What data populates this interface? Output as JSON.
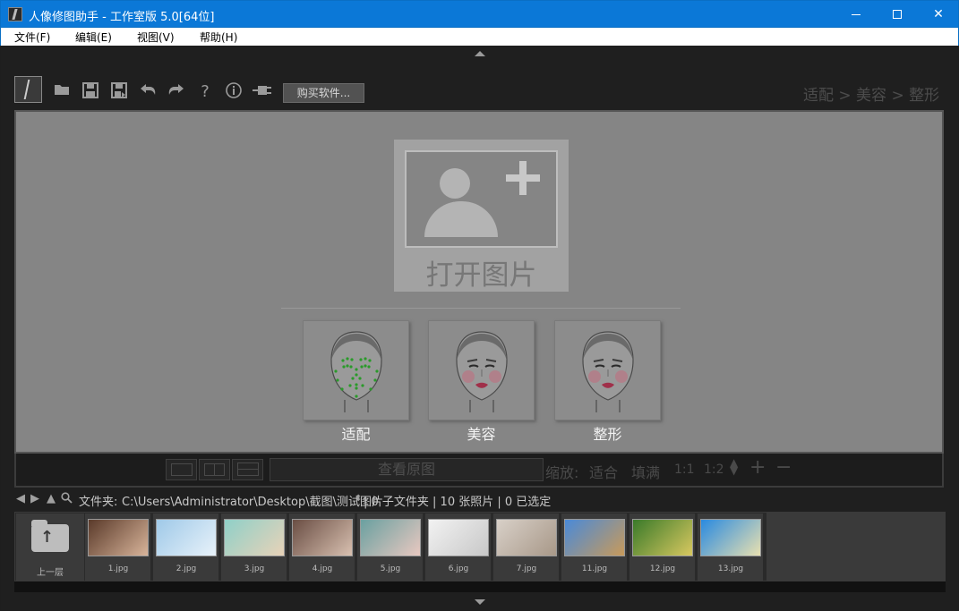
{
  "window": {
    "title": "人像修图助手 - 工作室版 5.0[64位]"
  },
  "menu": {
    "items": [
      {
        "label": "文件(F)"
      },
      {
        "label": "编辑(E)"
      },
      {
        "label": "视图(V)"
      },
      {
        "label": "帮助(H)"
      }
    ]
  },
  "toolbar": {
    "icons": [
      "logo-icon",
      "open-folder-icon",
      "save-icon",
      "save-as-icon",
      "undo-icon",
      "redo-icon",
      "help-icon",
      "info-icon",
      "plugin-icon"
    ],
    "buy_label": "购买软件...",
    "workflow": "适配 > 美容 > 整形"
  },
  "canvas": {
    "open_label": "打开图片",
    "modes": [
      {
        "label": "适配"
      },
      {
        "label": "美容"
      },
      {
        "label": "整形"
      }
    ]
  },
  "controls": {
    "view_original": "查看原图",
    "zoom_label": "缩放:",
    "fit_label": "适合",
    "fill_label": "填满",
    "ratio_1": "1:1",
    "ratio_2": "1:2",
    "plus": "+",
    "minus": "−"
  },
  "pathbar": {
    "folder_label": "文件夹:",
    "path": "C:\\Users\\Administrator\\Desktop\\截图\\测试图片",
    "stats": "| 0 子文件夹 | 10 张照片 | 0 已选定"
  },
  "thumbnails": {
    "up_label": "上一层",
    "files": [
      {
        "name": "1.jpg",
        "colors": [
          "#5a3a2a",
          "#d8b49a"
        ]
      },
      {
        "name": "2.jpg",
        "colors": [
          "#9fc9e8",
          "#e8f2fa"
        ]
      },
      {
        "name": "3.jpg",
        "colors": [
          "#8fd0c8",
          "#e8d2b8"
        ]
      },
      {
        "name": "4.jpg",
        "colors": [
          "#6a4e44",
          "#d8c0b0"
        ]
      },
      {
        "name": "5.jpg",
        "colors": [
          "#6aa0a0",
          "#e8c8c0"
        ]
      },
      {
        "name": "6.jpg",
        "colors": [
          "#f2f2f2",
          "#c8c8c8"
        ]
      },
      {
        "name": "7.jpg",
        "colors": [
          "#d8d0c8",
          "#a89888"
        ]
      },
      {
        "name": "11.jpg",
        "colors": [
          "#4a8ad8",
          "#c89a5a"
        ]
      },
      {
        "name": "12.jpg",
        "colors": [
          "#3a7a2a",
          "#d8c860"
        ]
      },
      {
        "name": "13.jpg",
        "colors": [
          "#2a8ae0",
          "#e8e0b0"
        ]
      }
    ]
  }
}
